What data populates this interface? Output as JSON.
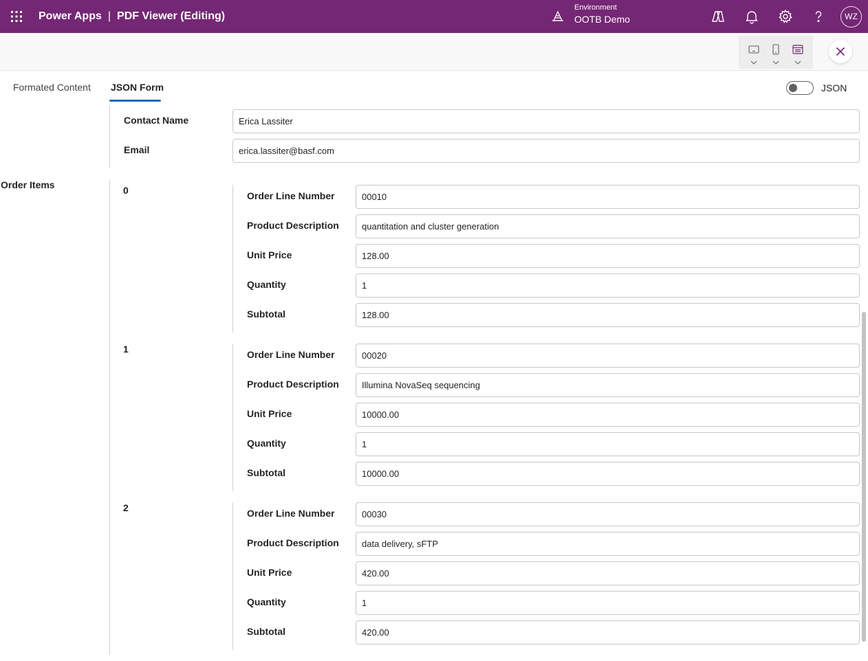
{
  "app": {
    "name": "Power Apps",
    "separator": "|",
    "title": "PDF Viewer (Editing)"
  },
  "environment": {
    "label": "Environment",
    "name": "OOTB Demo"
  },
  "user": {
    "initials": "WZ"
  },
  "icons": {
    "waffle": "app-launcher-icon",
    "environment": "environment-icon",
    "copilot": "copilot-icon",
    "notifications": "bell-icon",
    "settings": "gear-icon",
    "help": "help-icon",
    "tablet": "tablet-icon",
    "phone": "phone-icon",
    "web": "web-layout-icon",
    "close": "close-icon"
  },
  "colors": {
    "brand": "#742774",
    "accent": "#0f6cbd",
    "close": "#742774"
  },
  "tabs": [
    {
      "label": "Formated Content",
      "selected": false
    },
    {
      "label": "JSON Form",
      "selected": true
    }
  ],
  "json_toggle": {
    "label": "JSON",
    "on": false
  },
  "contact": {
    "name_label": "Contact Name",
    "name_value": "Erica Lassiter",
    "email_label": "Email",
    "email_value": "erica.lassiter@basf.com"
  },
  "order_items": {
    "label": "Order Items",
    "field_labels": {
      "line": "Order Line Number",
      "desc": "Product Description",
      "price": "Unit Price",
      "qty": "Quantity",
      "subtotal": "Subtotal"
    },
    "items": [
      {
        "index": "0",
        "line": "00010",
        "desc": "quantitation and cluster generation",
        "price": "128.00",
        "qty": "1",
        "subtotal": "128.00"
      },
      {
        "index": "1",
        "line": "00020",
        "desc": "Illumina NovaSeq sequencing",
        "price": "10000.00",
        "qty": "1",
        "subtotal": "10000.00"
      },
      {
        "index": "2",
        "line": "00030",
        "desc": "data delivery, sFTP",
        "price": "420.00",
        "qty": "1",
        "subtotal": "420.00"
      }
    ]
  }
}
